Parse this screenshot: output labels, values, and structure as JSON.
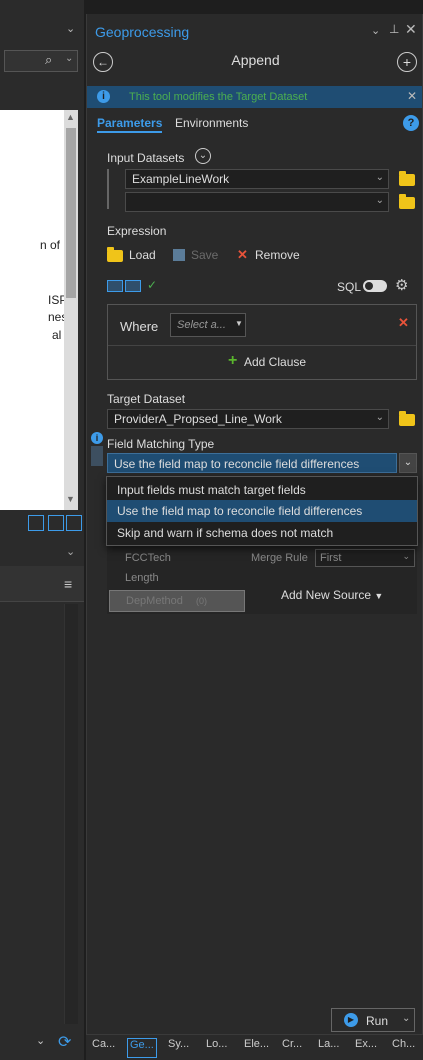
{
  "left": {
    "doc_lines": [
      "n of",
      "ISP",
      "nes",
      "al"
    ]
  },
  "gp": {
    "pane_title": "Geoprocessing",
    "pin_icon": "pin-icon",
    "close_icon": "close-icon",
    "tool_name": "Append",
    "info_banner": "This tool modifies the Target Dataset",
    "tabs": [
      "Parameters",
      "Environments"
    ],
    "input_datasets_label": "Input Datasets",
    "input_datasets_value": "ExampleLineWork",
    "input_datasets_value2": "",
    "expression_label": "Expression",
    "load_label": "Load",
    "save_label": "Save",
    "remove_label": "Remove",
    "sql_label": "SQL",
    "where_label": "Where",
    "where_placeholder": "Select a...",
    "add_clause_label": "Add Clause",
    "target_dataset_label": "Target Dataset",
    "target_dataset_value": "ProviderA_Propsed_Line_Work",
    "field_matching_label": "Field Matching Type",
    "field_matching_value": "Use the field map to reconcile field differences",
    "dropdown_options": [
      "Input fields must match target fields",
      "Use the field map to reconcile field differences",
      "Skip and warn if schema does not match"
    ],
    "field_list": [
      "FCCTech",
      "Length",
      "DepMethod"
    ],
    "depmethod_count": "(0)",
    "merge_rule_label": "Merge Rule",
    "merge_rule_value": "First",
    "add_new_source_label": "Add New Source",
    "run_label": "Run"
  },
  "bottom_tabs": [
    "Ca...",
    "Ge...",
    "Sy...",
    "Lo...",
    "Ele...",
    "Cr...",
    "La...",
    "Ex...",
    "Ch..."
  ],
  "colors": {
    "accent": "#3d9be9",
    "banner_bg": "#1f4d73",
    "selected_option": "#1f4d73",
    "remove_x": "#e8533a",
    "add_green": "#5ab52d",
    "folder": "#f0c419"
  }
}
